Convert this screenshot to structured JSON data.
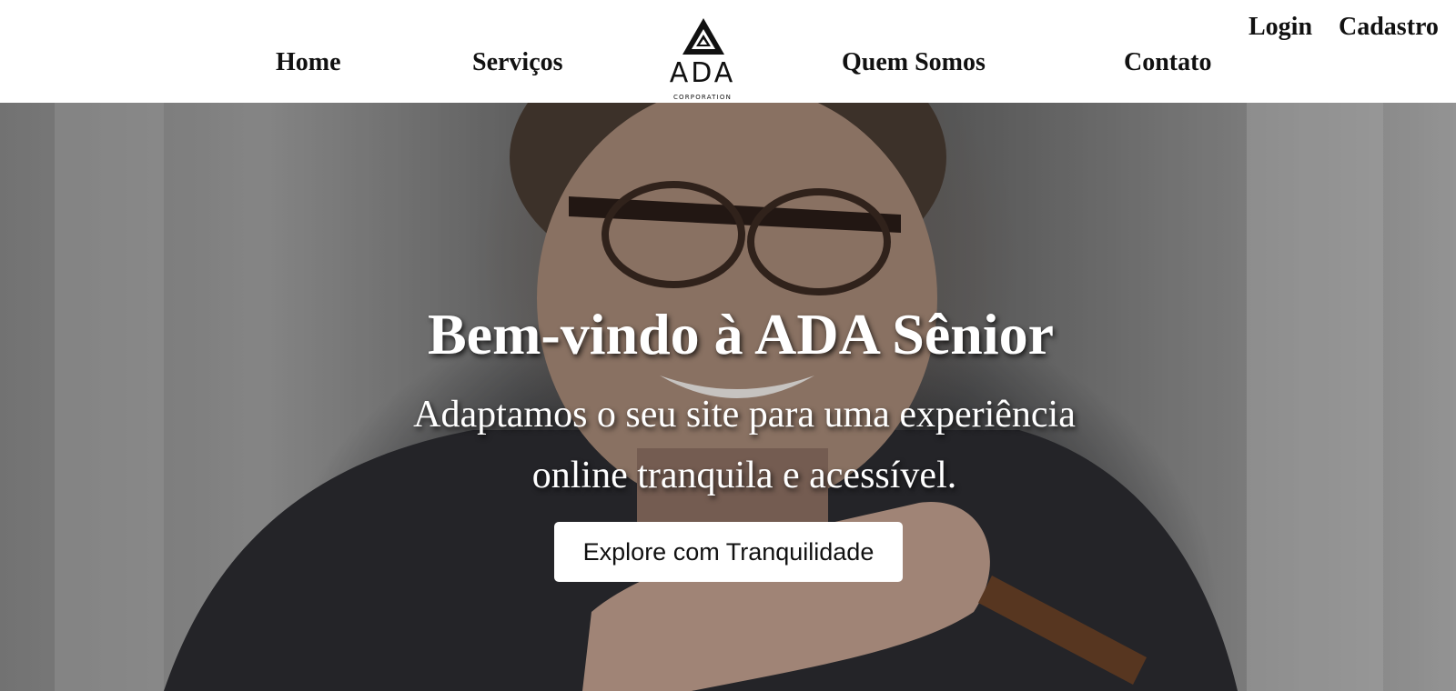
{
  "nav": {
    "left_items": [
      {
        "label": "Home"
      },
      {
        "label": "Serviços"
      }
    ],
    "right_items": [
      {
        "label": "Quem Somos"
      },
      {
        "label": "Contato"
      }
    ]
  },
  "auth": {
    "login_label": "Login",
    "signup_label": "Cadastro"
  },
  "logo": {
    "wordmark": "ADA",
    "subtitle": "CORPORATION"
  },
  "hero": {
    "title": "Bem-vindo à ADA Sênior",
    "subtitle": "Adaptamos o seu site para uma experiência online tranquila e acessível.",
    "cta_label": "Explore com Tranquilidade"
  }
}
